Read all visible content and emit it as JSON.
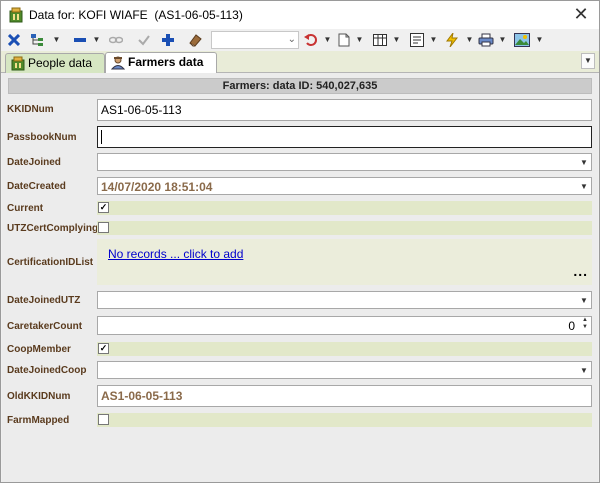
{
  "window": {
    "title": "Data for: KOFI WIAFE  (AS1-06-05-113)"
  },
  "icons": {
    "app": "app-icon",
    "close": "close-icon"
  },
  "tabs": [
    {
      "label": "People data",
      "active": false,
      "icon": "people-icon"
    },
    {
      "label": "Farmers data",
      "active": true,
      "icon": "farmer-icon"
    }
  ],
  "header": {
    "title": "Farmers: data ID: 540,027,635"
  },
  "fields": {
    "kkidnum": {
      "label": "KKIDNum",
      "value": "AS1-06-05-113"
    },
    "passbooknum": {
      "label": "PassbookNum",
      "value": ""
    },
    "datejoined": {
      "label": "DateJoined",
      "value": ""
    },
    "datecreated": {
      "label": "DateCreated",
      "value": "14/07/2020 18:51:04"
    },
    "current": {
      "label": "Current",
      "checked": true
    },
    "utzcertcomplying": {
      "label": "UTZCertComplying",
      "checked": false
    },
    "certificationidlist": {
      "label": "CertificationIDList",
      "link": "No records ... click to add",
      "more": "..."
    },
    "datejoinedutz": {
      "label": "DateJoinedUTZ",
      "value": ""
    },
    "caretakercount": {
      "label": "CaretakerCount",
      "value": "0"
    },
    "coopmember": {
      "label": "CoopMember",
      "checked": true
    },
    "datejoinedcoop": {
      "label": "DateJoinedCoop",
      "value": ""
    },
    "oldkkidnum": {
      "label": "OldKKIDNum",
      "value": "AS1-06-05-113"
    },
    "farmmapped": {
      "label": "FarmMapped",
      "checked": false
    }
  },
  "colors": {
    "label": "#5a3b1e",
    "readonly_value": "#8a6a4a",
    "checkbox_bg": "#e2e8c9",
    "tab_active": "#ffffff",
    "tab_inactive": "#d6e6c2",
    "link": "#0000cc"
  }
}
